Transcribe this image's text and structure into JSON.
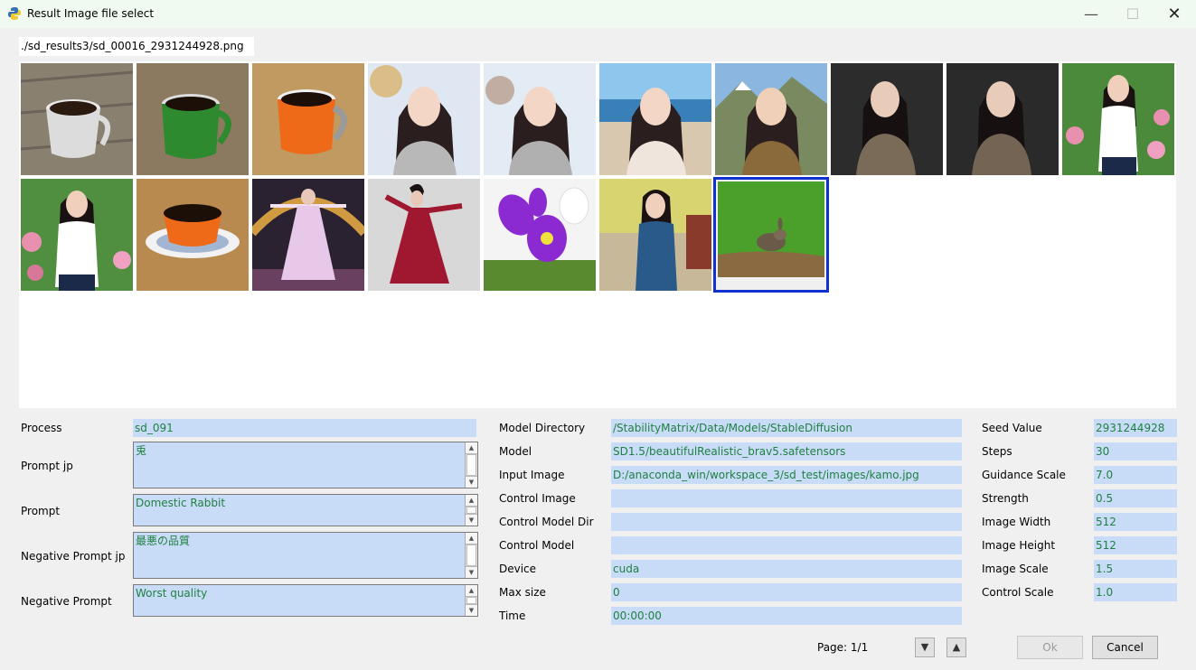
{
  "window": {
    "title": "Result Image file select",
    "minimize_icon": "minimize-icon",
    "maximize_icon": "maximize-icon",
    "close_icon": "close-icon"
  },
  "path": "./sd_results3/sd_00016_2931244928.png",
  "gallery": {
    "selected_index": 16,
    "images": [
      {
        "subject": "coffee cup on wooden table"
      },
      {
        "subject": "green coffee mug in water"
      },
      {
        "subject": "orange coffee mug in sand"
      },
      {
        "subject": "woman in snowy landscape"
      },
      {
        "subject": "woman in snowy landscape"
      },
      {
        "subject": "woman on beach"
      },
      {
        "subject": "woman in mountains"
      },
      {
        "subject": "woman against dark wall"
      },
      {
        "subject": "woman against dark wall"
      },
      {
        "subject": "woman in garden"
      },
      {
        "subject": "woman in garden"
      },
      {
        "subject": "orange cup on saucer in sand"
      },
      {
        "subject": "dancer on stage"
      },
      {
        "subject": "dancer in red dress"
      },
      {
        "subject": "purple orchids"
      },
      {
        "subject": "woman on autumn street"
      },
      {
        "subject": "rabbit in grass field"
      }
    ]
  },
  "left_fields": {
    "process": {
      "label": "Process",
      "value": "sd_091"
    },
    "prompt_jp": {
      "label": "Prompt jp",
      "value": "兎"
    },
    "prompt": {
      "label": "Prompt",
      "value": "Domestic Rabbit"
    },
    "neg_prompt_jp": {
      "label": "Negative Prompt jp",
      "value": "最悪の品質"
    },
    "neg_prompt": {
      "label": "Negative Prompt",
      "value": "Worst quality"
    }
  },
  "middle_fields": [
    {
      "label": "Model Directory",
      "value": "/StabilityMatrix/Data/Models/StableDiffusion"
    },
    {
      "label": "Model",
      "value": "SD1.5/beautifulRealistic_brav5.safetensors"
    },
    {
      "label": "Input Image",
      "value": "D:/anaconda_win/workspace_3/sd_test/images/kamo.jpg"
    },
    {
      "label": "Control Image",
      "value": ""
    },
    {
      "label": "Control Model Dir",
      "value": ""
    },
    {
      "label": "Control Model",
      "value": ""
    },
    {
      "label": "Device",
      "value": "cuda"
    },
    {
      "label": "Max size",
      "value": "0"
    },
    {
      "label": "Time",
      "value": "00:00:00"
    }
  ],
  "right_fields": [
    {
      "label": "Seed Value",
      "value": "2931244928"
    },
    {
      "label": "Steps",
      "value": "30"
    },
    {
      "label": "Guidance Scale",
      "value": "7.0"
    },
    {
      "label": "Strength",
      "value": "0.5"
    },
    {
      "label": "Image Width",
      "value": "512"
    },
    {
      "label": "Image Height",
      "value": "512"
    },
    {
      "label": "Image Scale",
      "value": "1.5"
    },
    {
      "label": "Control Scale",
      "value": "1.0"
    }
  ],
  "footer": {
    "page_text": "Page: 1/1",
    "page_down_icon": "triangle-down-icon",
    "page_up_icon": "triangle-up-icon",
    "ok_label": "Ok",
    "cancel_label": "Cancel"
  },
  "colors": {
    "field_bg": "#c8dcf8",
    "field_text": "#208040",
    "selection": "#1030d0"
  }
}
